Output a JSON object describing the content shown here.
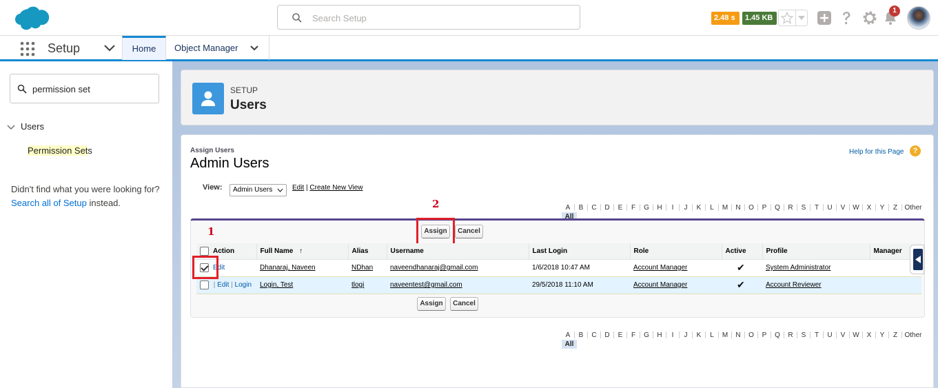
{
  "header": {
    "search_placeholder": "Search Setup",
    "perf_time": "2.48 s",
    "perf_size": "1.45 KB",
    "notification_count": "1"
  },
  "nav": {
    "app_name": "Setup",
    "tabs": [
      {
        "label": "Home"
      },
      {
        "label": "Object Manager"
      }
    ]
  },
  "sidebar": {
    "quickfind_value": "permission set",
    "tree_parent": "Users",
    "tree_child": "Permission Sets",
    "tree_child_highlight": "Permission Set",
    "tree_child_rest": "s",
    "no_result_text": "Didn't find what you were looking for?",
    "no_result_link": "Search all of Setup",
    "no_result_suffix": "instead."
  },
  "page_header": {
    "eyebrow": "SETUP",
    "title": "Users"
  },
  "list": {
    "crumb": "Assign Users",
    "title": "Admin Users",
    "help_link": "Help for this Page",
    "help_icon": "?",
    "view_label": "View:",
    "view_selected": "Admin Users",
    "edit_link": "Edit",
    "link_separator": "|",
    "create_view_link": "Create New View",
    "alphabet": [
      "A",
      "B",
      "C",
      "D",
      "E",
      "F",
      "G",
      "H",
      "I",
      "J",
      "K",
      "L",
      "M",
      "N",
      "O",
      "P",
      "Q",
      "R",
      "S",
      "T",
      "U",
      "V",
      "W",
      "X",
      "Y",
      "Z"
    ],
    "alpha_other": "Other",
    "alpha_all": "All",
    "assign_label": "Assign",
    "cancel_label": "Cancel",
    "columns": [
      "Action",
      "Full Name",
      "Alias",
      "Username",
      "Last Login",
      "Role",
      "Active",
      "Profile",
      "Manager"
    ],
    "sort_indicator": "↑",
    "rows": [
      {
        "checked": true,
        "actions": [
          "Edit"
        ],
        "full_name": "Dhanaraj, Naveen",
        "alias": "NDhan",
        "username": "naveendhanaraj@gmail.com",
        "last_login": "1/6/2018 10:47 AM",
        "role": "Account Manager",
        "active": "✔",
        "profile": "System Administrator",
        "manager": ""
      },
      {
        "checked": false,
        "actions": [
          "Edit",
          "Login"
        ],
        "full_name": "Login, Test",
        "alias": "tlogi",
        "username": "naveentest@gmail.com",
        "last_login": "29/5/2018 11:10 AM",
        "role": "Account Manager",
        "active": "✔",
        "profile": "Account Reviewer",
        "manager": ""
      }
    ]
  },
  "annotations": {
    "callout_1": "1",
    "callout_2": "2",
    "color": "#e0202a"
  },
  "colors": {
    "brand": "#1589d1",
    "header_icon_bg": "#3c97dd",
    "list_accent": "#56458c"
  }
}
